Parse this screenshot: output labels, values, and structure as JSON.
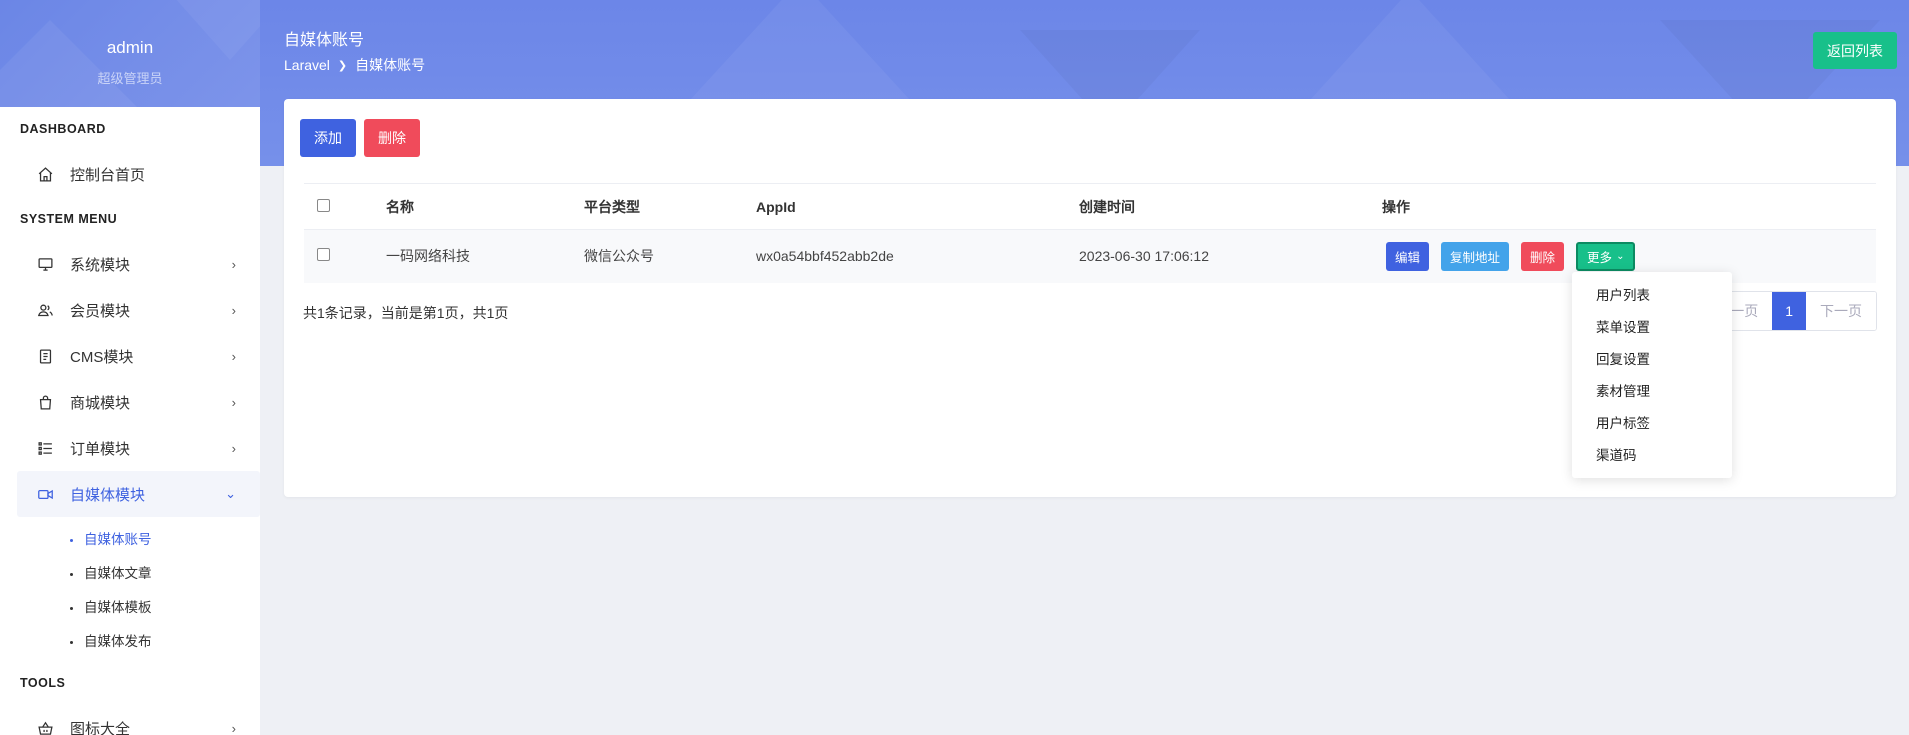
{
  "sidebar": {
    "username": "admin",
    "role": "超级管理员",
    "sections": {
      "dashboard": "DASHBOARD",
      "system_menu": "SYSTEM MENU",
      "tools": "TOOLS"
    },
    "items": {
      "console": "控制台首页",
      "system": "系统模块",
      "member": "会员模块",
      "cms": "CMS模块",
      "mall": "商城模块",
      "order": "订单模块",
      "media": "自媒体模块",
      "icons": "图标大全"
    },
    "media_sub": [
      "自媒体账号",
      "自媒体文章",
      "自媒体模板",
      "自媒体发布"
    ]
  },
  "header": {
    "title": "自媒体账号",
    "breadcrumb_root": "Laravel",
    "breadcrumb_current": "自媒体账号",
    "back_label": "返回列表"
  },
  "toolbar": {
    "add_label": "添加",
    "delete_label": "删除"
  },
  "table": {
    "columns": [
      "名称",
      "平台类型",
      "AppId",
      "创建时间",
      "操作"
    ],
    "rows": [
      {
        "name": "一码网络科技",
        "platform": "微信公众号",
        "appid": "wx0a54bbf452abb2de",
        "created": "2023-06-30 17:06:12"
      }
    ],
    "row_actions": {
      "edit": "编辑",
      "copy": "复制地址",
      "delete": "删除",
      "more": "更多"
    }
  },
  "more_menu": [
    "用户列表",
    "菜单设置",
    "回复设置",
    "素材管理",
    "用户标签",
    "渠道码"
  ],
  "pagination": {
    "info": "共1条记录，当前是第1页，共1页",
    "prev": "上一页",
    "current": "1",
    "next": "下一页"
  },
  "colors": {
    "primary": "#3f62e0",
    "danger": "#f04b5b",
    "success": "#18c08a",
    "info": "#43a3ea",
    "header_bg": "#6c86e8"
  }
}
